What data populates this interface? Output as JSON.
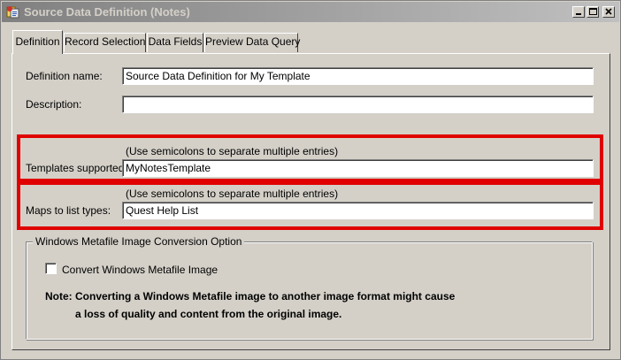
{
  "window": {
    "title": "Source Data Definition (Notes)"
  },
  "title_buttons": {
    "minimize_icon": "minimize-icon",
    "maximize_icon": "maximize-icon",
    "close_icon": "close-icon"
  },
  "tabs": [
    {
      "label": "Definition",
      "active": true
    },
    {
      "label": "Record Selection",
      "active": false
    },
    {
      "label": "Data Fields",
      "active": false
    },
    {
      "label": "Preview Data Query",
      "active": false
    }
  ],
  "form": {
    "definition_name_label": "Definition name:",
    "definition_name_value": "Source Data Definition for My Template",
    "description_label": "Description:",
    "description_value": "",
    "templates_hint": "(Use semicolons to separate multiple entries)",
    "templates_label": "Templates supported:",
    "templates_value": "MyNotesTemplate",
    "maps_hint": "(Use semicolons to separate multiple entries)",
    "maps_label": "Maps to list types:",
    "maps_value": "Quest Help List"
  },
  "conversion": {
    "group_title": "Windows Metafile Image Conversion Option",
    "checkbox_label": "Convert Windows Metafile Image",
    "checkbox_checked": false,
    "note_line1": "Note: Converting a Windows Metafile image to another image format might cause",
    "note_line2": "a loss of quality and content from the original image."
  },
  "colors": {
    "highlight": "#e00000",
    "title_text": "#d4d0c8",
    "face": "#d4d0c8"
  }
}
